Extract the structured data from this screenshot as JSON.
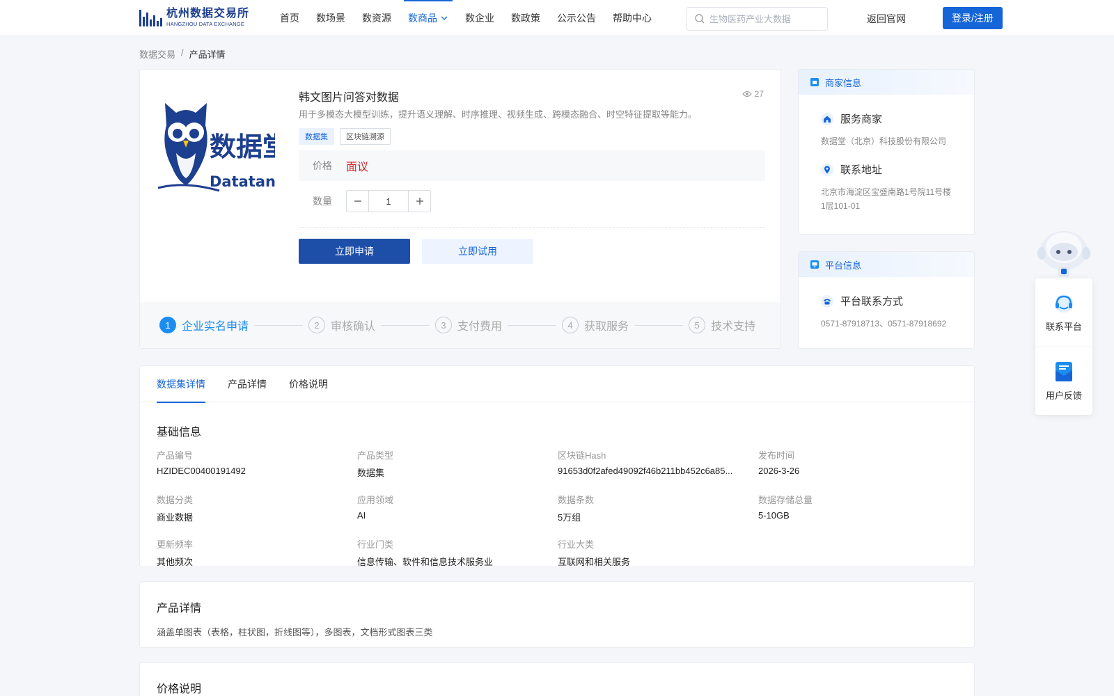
{
  "header": {
    "logo_cn": "杭州数据交易所",
    "logo_en": "HANGZHOU DATA EXCHANGE",
    "nav": [
      {
        "label": "首页"
      },
      {
        "label": "数场景"
      },
      {
        "label": "数资源"
      },
      {
        "label": "数商品",
        "active": true
      },
      {
        "label": "数企业"
      },
      {
        "label": "数政策"
      },
      {
        "label": "公示公告"
      },
      {
        "label": "帮助中心"
      }
    ],
    "search_placeholder": "生物医药产业大数据",
    "back_label": "返回官网",
    "login_label": "登录/注册",
    "accent": "#1565d8"
  },
  "breadcrumb": {
    "root": "数据交易",
    "sep": "/",
    "current": "产品详情"
  },
  "product": {
    "title": "韩文图片问答对数据",
    "views": "27",
    "description": "用于多模态大模型训练，提升语义理解、时序推理、视频生成、跨模态融合、时空特征提取等能力。",
    "tags": [
      "数据集",
      "区块链溯源"
    ],
    "price_label": "价格",
    "price_value": "面议",
    "qty_label": "数量",
    "qty_value": "1",
    "apply_label": "立即申请",
    "trial_label": "立即试用",
    "brand_cn": "数据堂",
    "brand_en": "Datatang"
  },
  "steps": [
    {
      "num": "1",
      "label": "企业实名申请",
      "active": true
    },
    {
      "num": "2",
      "label": "审核确认"
    },
    {
      "num": "3",
      "label": "支付费用"
    },
    {
      "num": "4",
      "label": "获取服务"
    },
    {
      "num": "5",
      "label": "技术支持"
    }
  ],
  "merchant": {
    "head": "商家信息",
    "service_title": "服务商家",
    "service_value": "数据堂（北京）科技股份有限公司",
    "address_title": "联系地址",
    "address_value": "北京市海淀区宝盛南路1号院11号楼1层101-01"
  },
  "platform": {
    "head": "平台信息",
    "contact_title": "平台联系方式",
    "contact_value": "0571-87918713、0571-87918692"
  },
  "float": {
    "contact_label": "联系平台",
    "feedback_label": "用户反馈"
  },
  "tabs": [
    {
      "label": "数据集详情",
      "active": true
    },
    {
      "label": "产品详情"
    },
    {
      "label": "价格说明"
    }
  ],
  "basic_info": {
    "title": "基础信息",
    "fields": [
      {
        "label": "产品编号",
        "value": "HZIDEC00400191492"
      },
      {
        "label": "产品类型",
        "value": "数据集"
      },
      {
        "label": "区块链Hash",
        "value": "91653d0f2afed49092f46b211bb452c6a85..."
      },
      {
        "label": "发布时间",
        "value": "2026-3-26"
      },
      {
        "label": "数据分类",
        "value": "商业数据"
      },
      {
        "label": "应用领域",
        "value": "AI"
      },
      {
        "label": "数据条数",
        "value": "5万组"
      },
      {
        "label": "数据存储总量",
        "value": "5-10GB"
      },
      {
        "label": "更新频率",
        "value": "其他频次"
      },
      {
        "label": "行业门类",
        "value": "信息传输、软件和信息技术服务业"
      },
      {
        "label": "行业大类",
        "value": "互联网和相关服务"
      }
    ]
  },
  "detail": {
    "title": "产品详情",
    "text": "涵盖单图表（表格，柱状图，折线图等），多图表，文档形式图表三类"
  },
  "price_section": {
    "title": "价格说明"
  }
}
